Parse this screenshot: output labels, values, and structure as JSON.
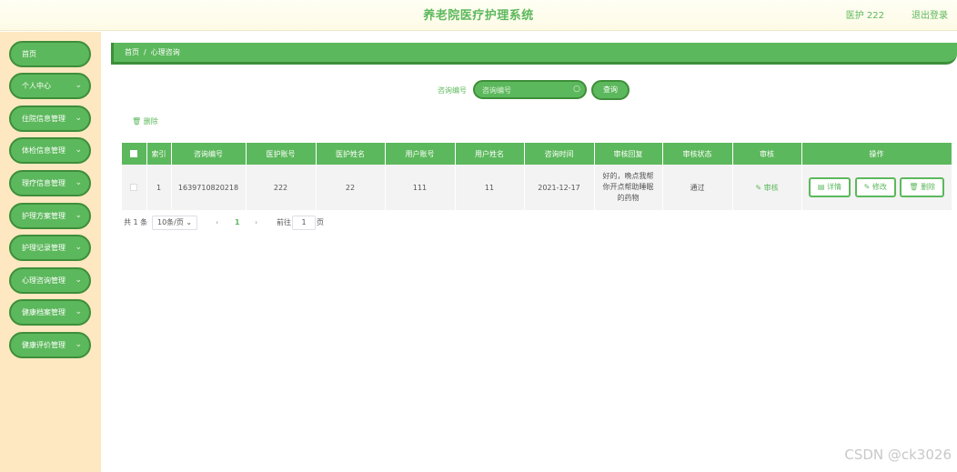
{
  "header": {
    "title": "养老院医疗护理系统",
    "user": "医护 222",
    "logout": "退出登录"
  },
  "sidebar": {
    "items": [
      {
        "label": "首页",
        "chevron": false
      },
      {
        "label": "个人中心",
        "chevron": true
      },
      {
        "label": "住院信息管理",
        "chevron": true
      },
      {
        "label": "体检信息管理",
        "chevron": true
      },
      {
        "label": "理疗信息管理",
        "chevron": true
      },
      {
        "label": "护理方案管理",
        "chevron": true
      },
      {
        "label": "护理记录管理",
        "chevron": true
      },
      {
        "label": "心理咨询管理",
        "chevron": true
      },
      {
        "label": "健康档案管理",
        "chevron": true
      },
      {
        "label": "健康评价管理",
        "chevron": true
      }
    ]
  },
  "breadcrumb": {
    "home": "首页",
    "sep": "/",
    "current": "心理咨询"
  },
  "search": {
    "label": "咨询编号",
    "placeholder": "咨询编号",
    "button": "查询"
  },
  "actions": {
    "delete": "删除"
  },
  "table": {
    "headers": [
      "",
      "索引",
      "咨询编号",
      "医护账号",
      "医护姓名",
      "用户账号",
      "用户姓名",
      "咨询时间",
      "审核回复",
      "审核状态",
      "审核",
      "操作"
    ],
    "rows": [
      {
        "index": "1",
        "consult_no": "1639710820218",
        "staff_account": "222",
        "staff_name": "22",
        "user_account": "111",
        "user_name": "11",
        "time": "2021-12-17",
        "reply": "好的，晚点我帮你开点帮助睡眠的药物",
        "status": "通过",
        "audit": "审核",
        "ops": {
          "detail": "详情",
          "edit": "修改",
          "delete": "删除"
        }
      }
    ]
  },
  "pagination": {
    "total": "共 1 条",
    "page_size": "10条/页",
    "current": "1",
    "goto": "前往",
    "goto_value": "1",
    "page_unit": "页"
  },
  "watermark": "CSDN @ck3026",
  "colors": {
    "accent": "#5cb85c",
    "accent_dark": "#3e8e3a",
    "sidebar_bg": "#fde8c1"
  }
}
